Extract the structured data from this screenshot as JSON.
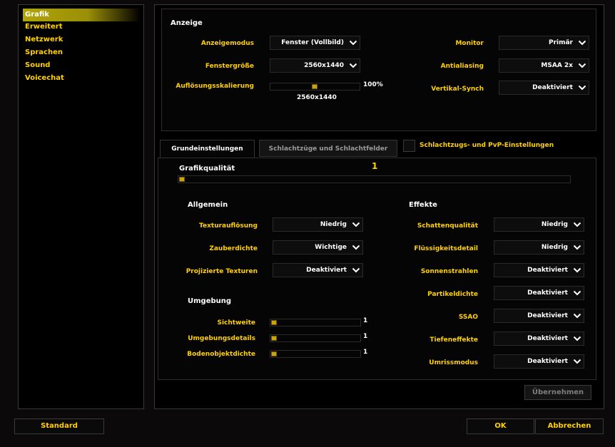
{
  "sidebar": {
    "items": [
      {
        "label": "Grafik",
        "selected": true
      },
      {
        "label": "Erweitert"
      },
      {
        "label": "Netzwerk"
      },
      {
        "label": "Sprachen"
      },
      {
        "label": "Sound"
      },
      {
        "label": "Voicechat"
      }
    ]
  },
  "display": {
    "heading": "Anzeige",
    "mode_label": "Anzeigemodus",
    "mode_value": "Fenster (Vollbild)",
    "window_size_label": "Fenstergröße",
    "window_size_value": "2560x1440",
    "render_scale_label": "Auflösungsskalierung",
    "render_scale_percent": "100%",
    "render_scale_level": 0.5,
    "render_scale_resolution": "2560x1440",
    "monitor_label": "Monitor",
    "monitor_value": "Primär",
    "antialiasing_label": "Antialiasing",
    "antialiasing_value": "MSAA 2x",
    "vsync_label": "Vertikal-Synch",
    "vsync_value": "Deaktiviert"
  },
  "tabs": {
    "basic": "Grundeinstellungen",
    "raids": "Schlachtzüge und Schlachtfelder",
    "raid_checkbox_label": "Schlachtzugs- und PvP-Einstellungen",
    "raid_checkbox_checked": false
  },
  "quality": {
    "label": "Grafikqualität",
    "value": "1",
    "level": 0
  },
  "general": {
    "heading": "Allgemein",
    "items": [
      {
        "label": "Texturauflösung",
        "value": "Niedrig"
      },
      {
        "label": "Zauberdichte",
        "value": "Wichtige"
      },
      {
        "label": "Projizierte Texturen",
        "value": "Deaktiviert"
      }
    ]
  },
  "environment": {
    "heading": "Umgebung",
    "items": [
      {
        "label": "Sichtweite",
        "value": "1",
        "level": 0
      },
      {
        "label": "Umgebungsdetails",
        "value": "1",
        "level": 0
      },
      {
        "label": "Bodenobjektdichte",
        "value": "1",
        "level": 0
      }
    ]
  },
  "effects": {
    "heading": "Effekte",
    "items": [
      {
        "label": "Schattenqualität",
        "value": "Niedrig"
      },
      {
        "label": "Flüssigkeitsdetail",
        "value": "Niedrig"
      },
      {
        "label": "Sonnenstrahlen",
        "value": "Deaktiviert"
      },
      {
        "label": "Partikeldichte",
        "value": "Deaktiviert"
      },
      {
        "label": "SSAO",
        "value": "Deaktiviert"
      },
      {
        "label": "Tiefeneffekte",
        "value": "Deaktiviert"
      },
      {
        "label": "Umrissmodus",
        "value": "Deaktiviert"
      }
    ]
  },
  "buttons": {
    "apply": "Übernehmen",
    "default": "Standard",
    "ok": "OK",
    "cancel": "Abbrechen"
  },
  "colors": {
    "accent_gold": "#ffd100",
    "slider_thumb": "#c9a40d",
    "selected_highlight": "#b1a408"
  },
  "icons": {
    "dropdown": "chevron-down-icon",
    "checkbox": "checkbox-icon"
  }
}
